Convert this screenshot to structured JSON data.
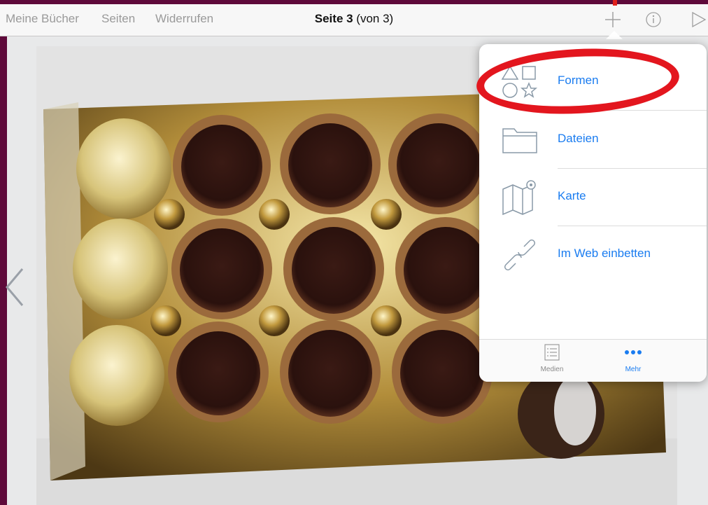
{
  "toolbar": {
    "my_books": "Meine Bücher",
    "pages": "Seiten",
    "undo": "Widerrufen",
    "page_title_bold": "Seite 3",
    "page_title_rest": " (von 3)"
  },
  "icons": {
    "add": "plus-icon",
    "info": "info-icon",
    "play": "play-icon",
    "prev": "chevron-left-icon"
  },
  "popover": {
    "items": [
      {
        "label": "Formen",
        "icon": "shapes-icon"
      },
      {
        "label": "Dateien",
        "icon": "folder-icon"
      },
      {
        "label": "Karte",
        "icon": "map-icon"
      },
      {
        "label": "Im Web einbetten",
        "icon": "link-icon"
      }
    ],
    "tabs": [
      {
        "label": "Medien",
        "icon": "list-icon",
        "active": false
      },
      {
        "label": "Mehr",
        "icon": "more-icon",
        "active": true
      }
    ]
  },
  "colors": {
    "accent": "#1a7cf0",
    "highlight": "#e3161e",
    "frame": "#5e0a3a"
  }
}
